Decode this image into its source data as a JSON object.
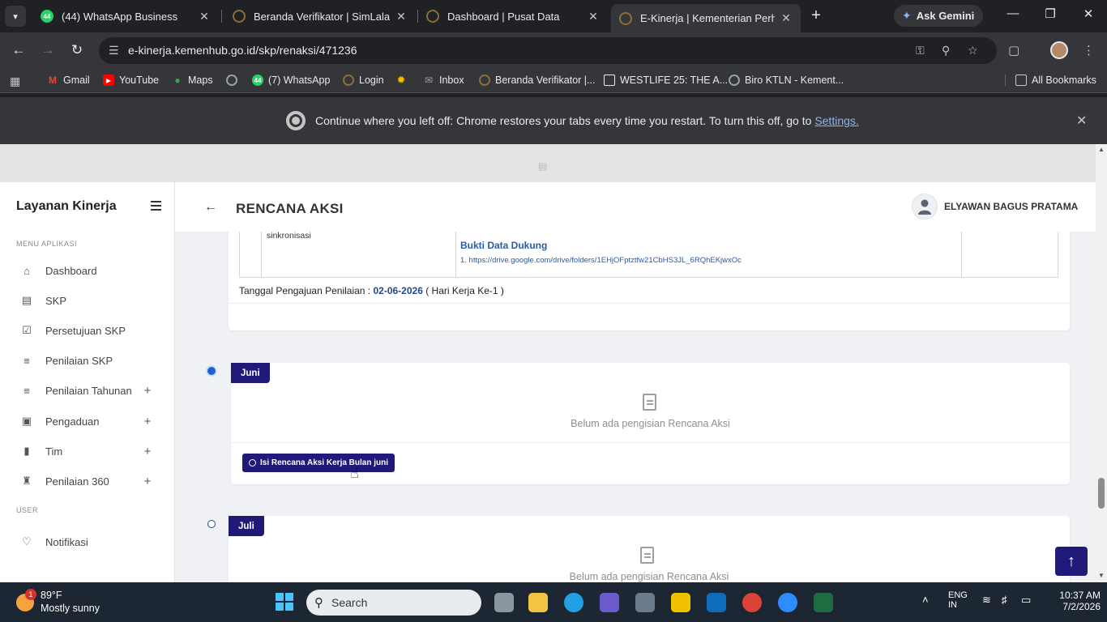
{
  "browser": {
    "tabs": [
      {
        "title": "(44) WhatsApp Business",
        "icon_badge": "44",
        "icon_color": "#25d366",
        "active": false
      },
      {
        "title": "Beranda Verifikator | SimLala",
        "icon_color": "#8a6d3b",
        "active": false
      },
      {
        "title": "Dashboard | Pusat Data",
        "icon_color": "#8a6d3b",
        "active": false
      },
      {
        "title": "E-Kinerja | Kementerian Perhub",
        "icon_color": "#8a6d3b",
        "active": true
      }
    ],
    "gemini_label": "Ask Gemini",
    "url": "e-kinerja.kemenhub.go.id/skp/renaksi/471236",
    "bookmarks": [
      {
        "label": "Gmail",
        "icon": "gmail-icon",
        "color": "#ea4335"
      },
      {
        "label": "YouTube",
        "icon": "youtube-icon",
        "color": "#ff0000"
      },
      {
        "label": "Maps",
        "icon": "maps-icon",
        "color": "#34a853"
      },
      {
        "label": "",
        "icon": "globe-icon",
        "color": "#9aa0a6"
      },
      {
        "label": "(7) WhatsApp",
        "icon": "whatsapp-icon",
        "color": "#25d366"
      },
      {
        "label": "Login",
        "icon": "globe-icon",
        "color": "#8a6d3b"
      },
      {
        "label": "",
        "icon": "pinwheel-icon",
        "color": "#fbbc05"
      },
      {
        "label": "Inbox",
        "icon": "mail-icon",
        "color": "#9aa0a6"
      },
      {
        "label": "Beranda Verifikator |...",
        "icon": "globe-icon",
        "color": "#8a6d3b"
      },
      {
        "label": "WESTLIFE 25: THE A...",
        "icon": "page-icon",
        "color": "#ffffff"
      },
      {
        "label": "Biro KTLN - Kement...",
        "icon": "globe-icon",
        "color": "#9aa0a6"
      }
    ],
    "all_bookmarks_label": "All Bookmarks",
    "infobar": {
      "text": "Continue where you left off: Chrome restores your tabs every time you restart. To turn this off, go to",
      "link": "Settings."
    }
  },
  "app": {
    "brand": "Layanan Kinerja",
    "menu_section_label": "MENU APLIKASI",
    "menu": [
      {
        "label": "Dashboard",
        "icon": "home-icon",
        "expandable": false
      },
      {
        "label": "SKP",
        "icon": "document-icon",
        "expandable": false
      },
      {
        "label": "Persetujuan SKP",
        "icon": "check-square-icon",
        "expandable": false
      },
      {
        "label": "Penilaian SKP",
        "icon": "list-check-icon",
        "expandable": false
      },
      {
        "label": "Penilaian Tahunan",
        "icon": "list-check-icon",
        "expandable": true
      },
      {
        "label": "Pengaduan",
        "icon": "message-icon",
        "expandable": true
      },
      {
        "label": "Tim",
        "icon": "tag-icon",
        "expandable": true
      },
      {
        "label": "Penilaian 360",
        "icon": "crown-icon",
        "expandable": true
      }
    ],
    "user_section_label": "USER",
    "user_menu": [
      {
        "label": "Notifikasi",
        "icon": "bell-icon"
      }
    ],
    "page_title": "RENCANA AKSI",
    "user_name": "ELYAWAN BAGUS PRATAMA"
  },
  "content": {
    "previous_entry": {
      "cell_text": "sinkronisasi",
      "bukti_title": "Bukti Data Dukung",
      "bukti_link": "1. https://drive.google.com/drive/folders/1EHjOFptztfw21CbHS3JL_6RQhEKjwxOc",
      "tanggal_label": "Tanggal Pengajuan Penilaian :",
      "tanggal_value": "02-06-2026",
      "tanggal_note": "( Hari Kerja Ke-1 )"
    },
    "months": [
      {
        "name": "Juni",
        "empty_text": "Belum ada pengisian Rencana Aksi",
        "button_label": "Isi Rencana Aksi Kerja Bulan juni"
      },
      {
        "name": "Juli",
        "empty_text": "Belum ada pengisian Rencana Aksi"
      }
    ]
  },
  "taskbar": {
    "weather_temp": "89°F",
    "weather_condition": "Mostly sunny",
    "weather_badge": "1",
    "search_placeholder": "Search",
    "lang_top": "ENG",
    "lang_bottom": "IN",
    "time": "10:37 AM",
    "date": "7/2/2026"
  },
  "colors": {
    "accent": "#1f1a7a",
    "link": "#2b5aa8"
  }
}
